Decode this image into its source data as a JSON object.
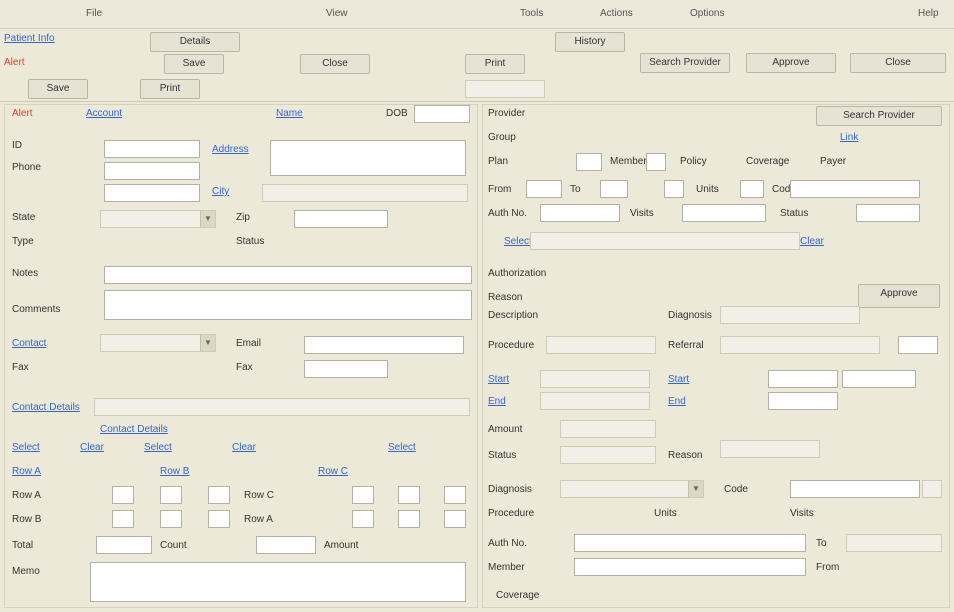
{
  "toolbar": {
    "items": [
      "File",
      "View",
      "Tools",
      "Actions",
      "Options",
      "Help"
    ]
  },
  "header": {
    "left_link": "Patient Info",
    "left_alert": "Alert",
    "tabs": [
      "Details",
      "History"
    ]
  },
  "left": {
    "status_red": "Alert",
    "account_link": "Account",
    "name_link": "Name",
    "dob_label": "DOB",
    "id_label": "ID",
    "phone_label": "Phone",
    "address_link": "Address",
    "city_label": "City",
    "state_label": "State",
    "zip_label": "Zip",
    "type_label": "Type",
    "status_label": "Status",
    "notes_label": "Notes",
    "comments_label": "Comments",
    "section_link": "Contact Details",
    "contact_link": "Contact",
    "email_label": "Email",
    "fax_label": "Fax",
    "row_labels": [
      "Row A",
      "Row B",
      "Row C"
    ],
    "bottom_labels": [
      "Total",
      "Count",
      "Amount"
    ],
    "memo_label": "Memo"
  },
  "right": {
    "header_label": "Provider",
    "right_button": "Search Provider",
    "group_label": "Group",
    "group_link": "Link",
    "plan_label": "Plan",
    "member_label": "Member",
    "policy_label": "Policy",
    "coverage_label": "Coverage",
    "payer_label": "Payer",
    "link1": "Select",
    "link2": "Clear",
    "section2": "Authorization",
    "auth_label": "Auth No.",
    "visits_label": "Visits",
    "from_label": "From",
    "to_label": "To",
    "start_link": "Start",
    "end_link": "End",
    "status_label": "Status",
    "reason_label": "Reason",
    "units_label": "Units",
    "code_label": "Code",
    "desc_label": "Description",
    "dx_label": "Diagnosis",
    "proc_label": "Procedure",
    "ref_label": "Referral",
    "amt_label": "Amount",
    "approve_button": "Approve"
  },
  "buttons": [
    "Save",
    "Close",
    "Print"
  ]
}
